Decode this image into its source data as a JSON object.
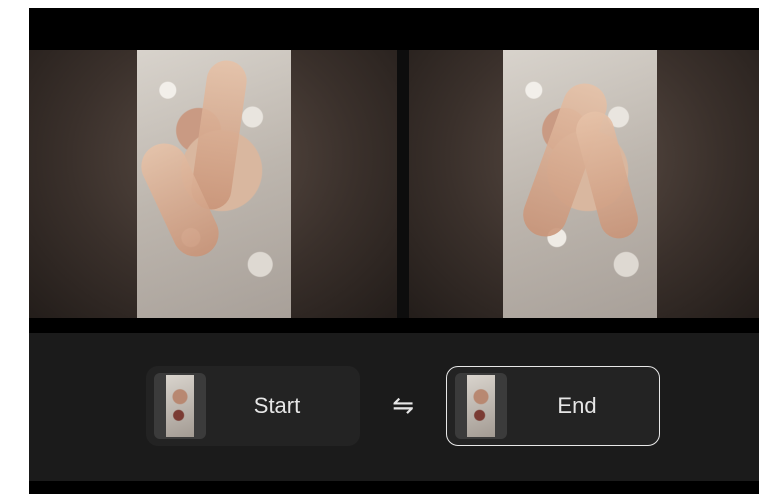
{
  "preview": {
    "panels": [
      {
        "id": "start",
        "image": "start-frame-photo"
      },
      {
        "id": "end",
        "image": "end-frame-photo"
      }
    ]
  },
  "controls": {
    "start_label": "Start",
    "end_label": "End",
    "swap_icon": "⇋",
    "selected": "end"
  },
  "colors": {
    "background": "#000000",
    "panel_bar": "#1b1b1b",
    "slot": "#232323",
    "selected_border": "#e8e8e8",
    "text": "#e6e6e6"
  }
}
